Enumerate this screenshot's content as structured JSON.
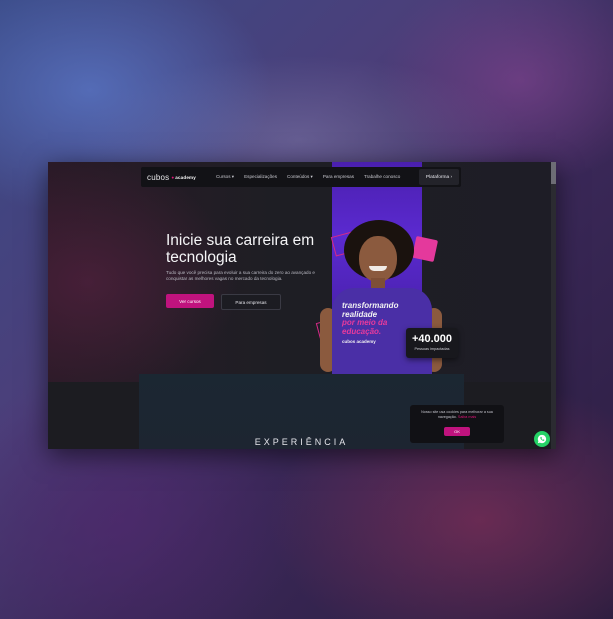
{
  "site": {
    "logo_text": "cubos",
    "logo_sub": "academy"
  },
  "nav": {
    "items": [
      {
        "label": "Cursos ▾"
      },
      {
        "label": "Especializações"
      },
      {
        "label": "Conteúdos ▾"
      },
      {
        "label": "Para empresas"
      },
      {
        "label": "Trabalhe conosco"
      }
    ],
    "platform_label": "Plataforma ›"
  },
  "hero": {
    "headline": "Inicie sua carreira em tecnologia",
    "subtext": "Tudo que você precisa para evoluir a sua carreira do zero ao avançado e conquistar as melhores vagas no mercado da tecnologia.",
    "primary_button": "Ver cursos",
    "secondary_button": "Para empresas"
  },
  "tshirt": {
    "line1": "transformando",
    "line2": "realidade",
    "line3": "por meio da",
    "line4": "educação.",
    "brand": "cubos academy"
  },
  "stat": {
    "value": "+40.000",
    "label": "Pessoas impactadas"
  },
  "section": {
    "title": "EXPERIÊNCIA"
  },
  "cookie": {
    "text": "Nosso site usa cookies para melhorar a sua navegação.",
    "link": "Saiba mais",
    "ok_label": "OK"
  },
  "icons": {
    "whatsapp": "whatsapp-icon"
  },
  "colors": {
    "accent": "#c0137e",
    "purple": "#5b2ad0",
    "whatsapp": "#25d366"
  }
}
